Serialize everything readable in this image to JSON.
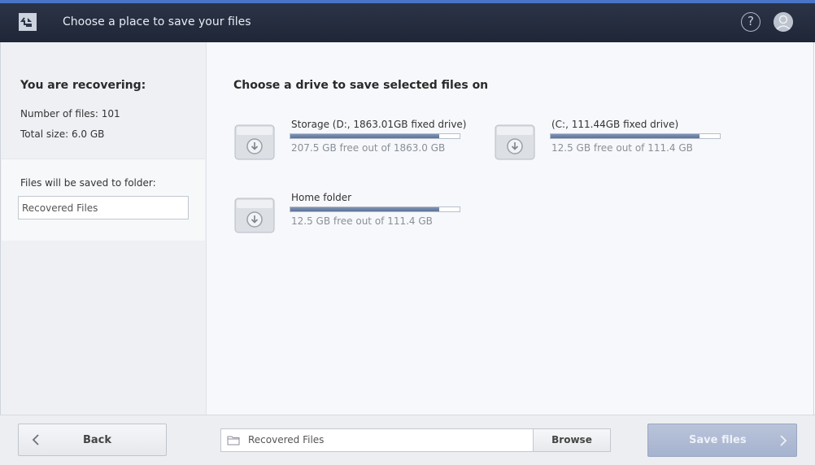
{
  "header": {
    "title": "Choose a place to save your files",
    "app_icon": "back-arrow-app-icon",
    "help_label": "?",
    "help_icon": "question-icon",
    "profile_icon": "user-icon",
    "accent_color": "#4a74c6"
  },
  "sidebar": {
    "recovering_title": "You are recovering:",
    "files_line": "Number of files: 101",
    "size_line": "Total size: 6.0 GB",
    "save_folder_label": "Files will be saved to folder:",
    "folder_value": "Recovered Files"
  },
  "main": {
    "title": "Choose a drive to save selected files on",
    "drives": [
      {
        "name": "Storage (D:, 1863.01GB fixed drive)",
        "free_text": "207.5 GB free out of 1863.0 GB",
        "used_fraction": 0.89,
        "icon": "drive-icon"
      },
      {
        "name": " (C:, 111.44GB fixed drive)",
        "free_text": "12.5 GB free out of 111.4 GB",
        "used_fraction": 0.89,
        "icon": "drive-icon"
      },
      {
        "name": "Home folder",
        "free_text": "12.5 GB free out of 111.4 GB",
        "used_fraction": 0.89,
        "icon": "drive-icon"
      }
    ]
  },
  "footer": {
    "back_label": "Back",
    "path_value": "Recovered Files",
    "browse_label": "Browse",
    "save_label": "Save files",
    "save_color": "#a9b6d0"
  }
}
